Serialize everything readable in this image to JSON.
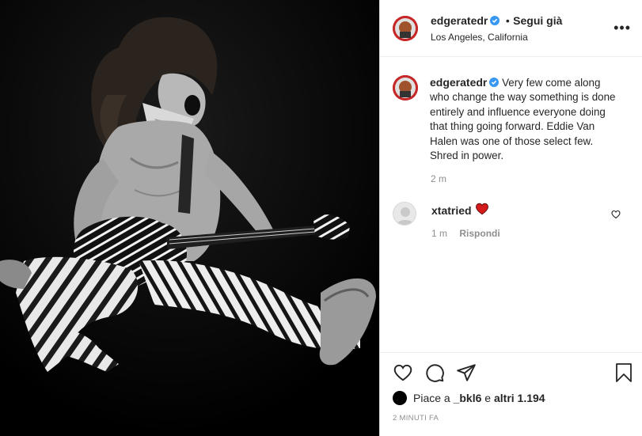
{
  "post": {
    "username": "edgeratedr",
    "follow_separator": "•",
    "follow_label": "Segui già",
    "location": "Los Angeles, California",
    "more_label": "•••"
  },
  "caption": {
    "username": "edgeratedr",
    "text": "Very few come along who change the way something is done entirely and influence everyone doing that thing going forward. Eddie Van Halen was one of those select few. Shred in power.",
    "time": "2 m"
  },
  "comment": {
    "username": "xtatried",
    "time": "1 m",
    "reply_label": "Rispondi"
  },
  "likes": {
    "prefix": "Piace a",
    "user": "_bkl6",
    "middle": "e",
    "count": "altri 1.194"
  },
  "timestamp": "2 MINUTI FA",
  "colors": {
    "verified": "#3897f0",
    "heart": "#ed4956"
  }
}
